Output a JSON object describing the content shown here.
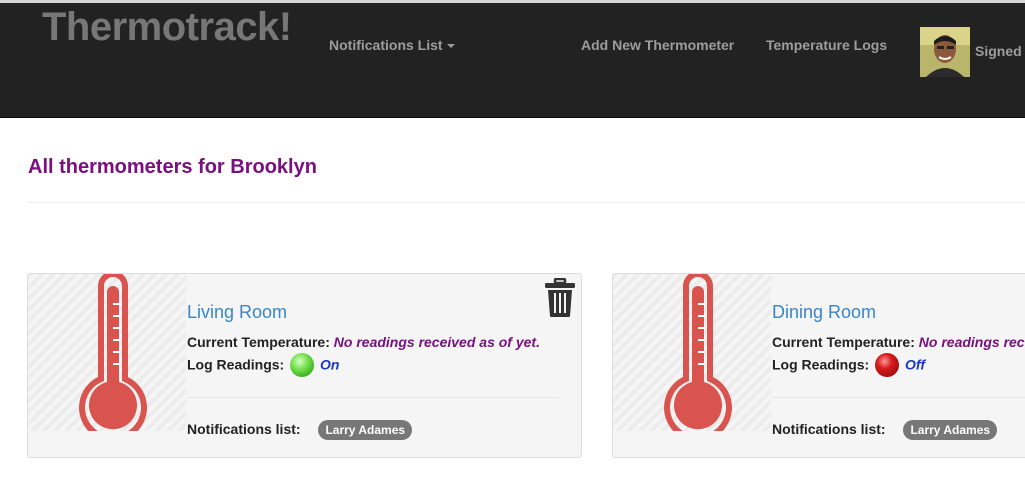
{
  "navbar": {
    "brand": "Thermotrack!",
    "notifications_label": "Notifications List",
    "add_thermometer": "Add New Thermometer",
    "temperature_logs": "Temperature Logs",
    "signed": "Signed"
  },
  "page": {
    "title": "All thermometers for Brooklyn"
  },
  "thermometers": [
    {
      "name": "Living Room",
      "current_temp_label": "Current Temperature:",
      "current_temp_value": "No readings received as of yet.",
      "log_label": "Log Readings:",
      "log_status": "On",
      "log_color": "#36b219",
      "notif_label": "Notifications list:",
      "notif_user": "Larry Adames"
    },
    {
      "name": "Dining Room",
      "current_temp_label": "Current Temperature:",
      "current_temp_value": "No readings received as of yet.",
      "log_label": "Log Readings:",
      "log_status": "Off",
      "log_color": "#a50d0d",
      "notif_label": "Notifications list:",
      "notif_user": "Larry Adames"
    }
  ],
  "colors": {
    "navbar_bg": "#222222",
    "title": "#7a0f80",
    "link": "#3a85c6",
    "thermometer": "#d9534f"
  },
  "icons": {
    "thermometer": "thermometer-icon",
    "trash": "trash-icon",
    "caret": "caret-down-icon"
  }
}
